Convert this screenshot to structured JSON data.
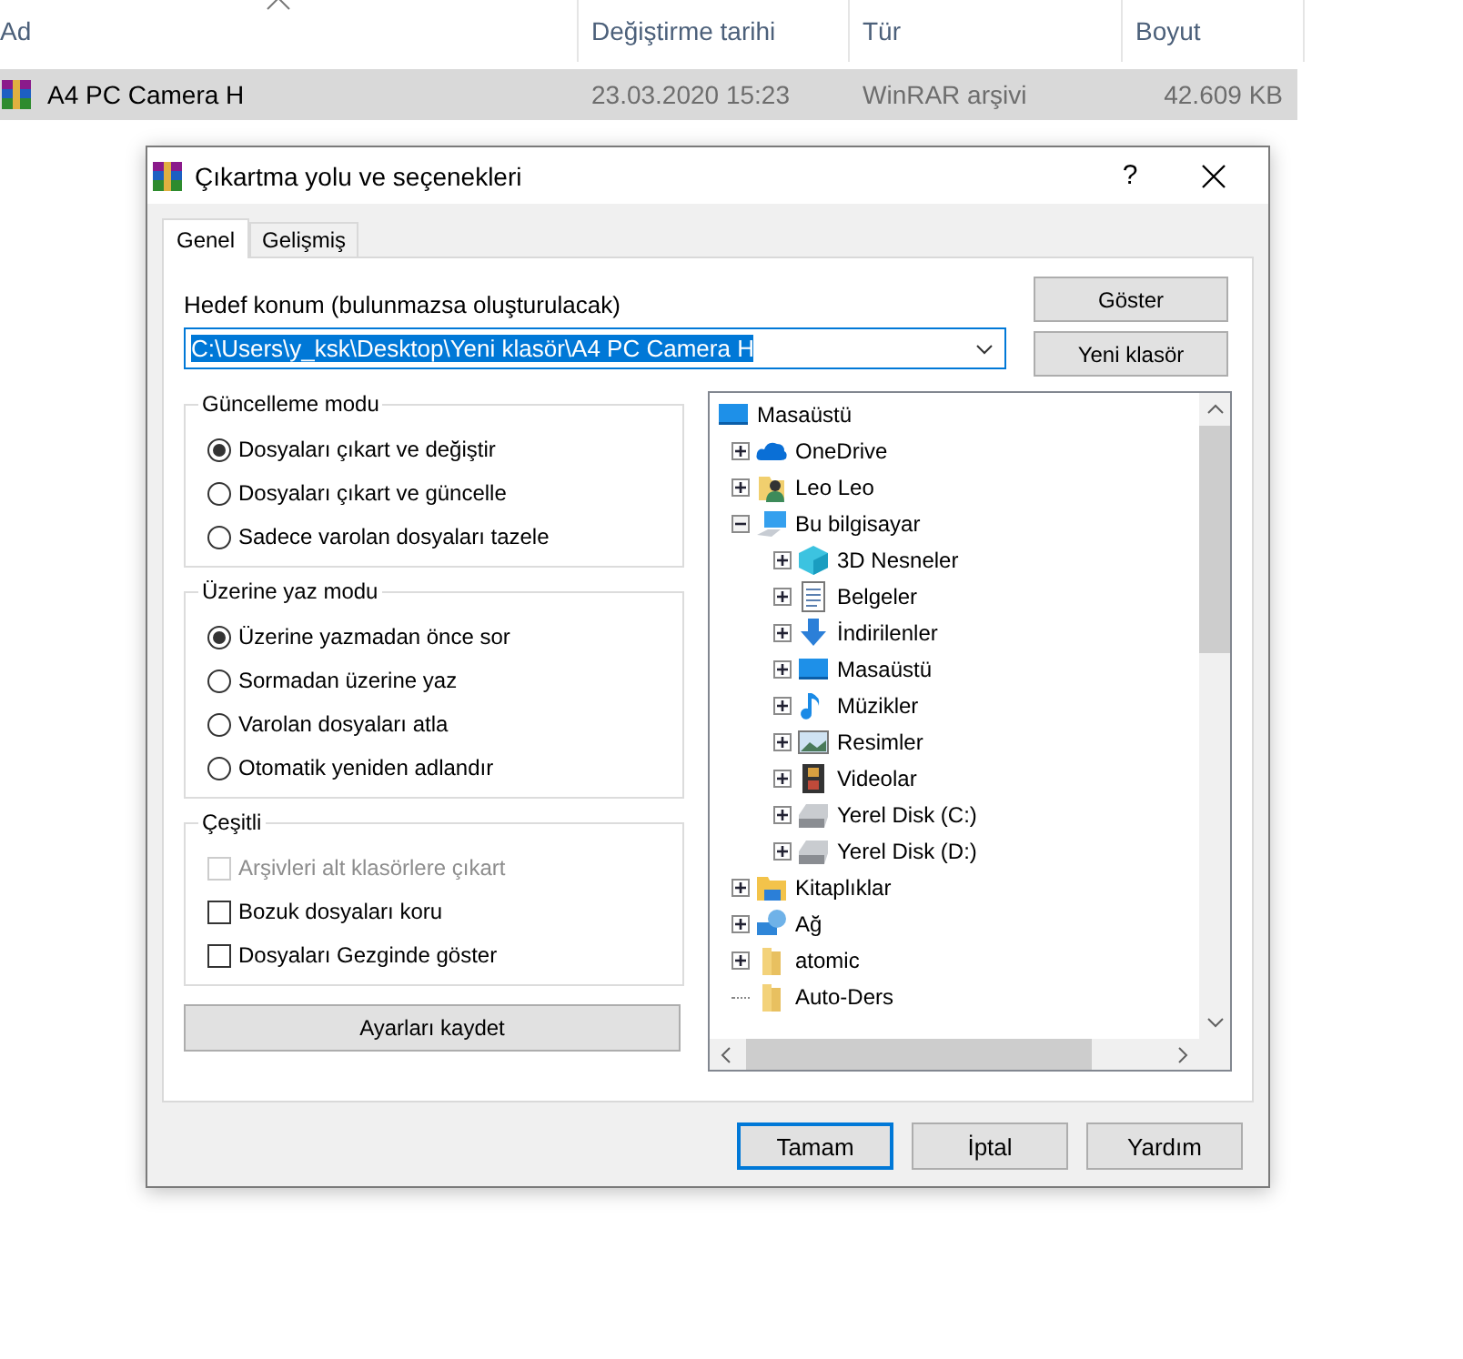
{
  "explorer": {
    "columns": [
      {
        "label": "Ad",
        "sorted": true
      },
      {
        "label": "Değiştirme tarihi",
        "sorted": false
      },
      {
        "label": "Tür",
        "sorted": false
      },
      {
        "label": "Boyut",
        "sorted": false
      }
    ],
    "rows": [
      {
        "name": "A4 PC Camera H",
        "date": "23.03.2020 15:23",
        "type": "WinRAR arşivi",
        "size": "42.609 KB",
        "selected": true
      }
    ]
  },
  "dialog": {
    "title": "Çıkartma yolu ve seçenekleri",
    "help": "?",
    "tabs": [
      {
        "label": "Genel",
        "selected": true
      },
      {
        "label": "Gelişmiş",
        "selected": false
      }
    ],
    "destination": {
      "label": "Hedef konum (bulunmazsa oluşturulacak)",
      "value": "C:\\Users\\y_ksk\\Desktop\\Yeni klasör\\A4 PC Camera H"
    },
    "side_buttons": [
      "Göster",
      "Yeni klasör"
    ],
    "radio_groups": [
      {
        "title": "Güncelleme modu",
        "options": [
          {
            "label": "Dosyaları çıkart ve değiştir",
            "selected": true
          },
          {
            "label": "Dosyaları çıkart ve güncelle",
            "selected": false
          },
          {
            "label": "Sadece varolan dosyaları tazele",
            "selected": false
          }
        ]
      },
      {
        "title": "Üzerine yaz modu",
        "options": [
          {
            "label": "Üzerine yazmadan önce sor",
            "selected": true
          },
          {
            "label": "Sormadan üzerine yaz",
            "selected": false
          },
          {
            "label": "Varolan dosyaları atla",
            "selected": false
          },
          {
            "label": "Otomatik yeniden adlandır",
            "selected": false
          }
        ]
      }
    ],
    "misc": {
      "title": "Çeşitli",
      "options": [
        {
          "label": "Arşivleri alt klasörlere çıkart",
          "checked": false,
          "disabled": true
        },
        {
          "label": "Bozuk dosyaları koru",
          "checked": false,
          "disabled": false
        },
        {
          "label": "Dosyaları Gezginde göster",
          "checked": false,
          "disabled": false
        }
      ]
    },
    "save_button": "Ayarları kaydet",
    "tree": {
      "label": "Masaüstü",
      "kind": "desktop",
      "children": [
        {
          "label": "OneDrive",
          "kind": "cloud",
          "expandable": true,
          "expanded": false
        },
        {
          "label": "Leo Leo",
          "kind": "user",
          "expandable": true,
          "expanded": false
        },
        {
          "label": "Bu bilgisayar",
          "kind": "computer",
          "expandable": true,
          "expanded": true,
          "children": [
            {
              "label": "3D Nesneler",
              "kind": "cube",
              "expandable": true,
              "expanded": false
            },
            {
              "label": "Belgeler",
              "kind": "document",
              "expandable": true,
              "expanded": false
            },
            {
              "label": "İndirilenler",
              "kind": "download",
              "expandable": true,
              "expanded": false
            },
            {
              "label": "Masaüstü",
              "kind": "desktop",
              "expandable": true,
              "expanded": false
            },
            {
              "label": "Müzikler",
              "kind": "music",
              "expandable": true,
              "expanded": false
            },
            {
              "label": "Resimler",
              "kind": "image",
              "expandable": true,
              "expanded": false
            },
            {
              "label": "Videolar",
              "kind": "video",
              "expandable": true,
              "expanded": false
            },
            {
              "label": "Yerel Disk (C:)",
              "kind": "disk",
              "expandable": true,
              "expanded": false
            },
            {
              "label": "Yerel Disk (D:)",
              "kind": "disk",
              "expandable": true,
              "expanded": false
            }
          ]
        },
        {
          "label": "Kitaplıklar",
          "kind": "library",
          "expandable": true,
          "expanded": false
        },
        {
          "label": "Ağ",
          "kind": "network",
          "expandable": true,
          "expanded": false
        },
        {
          "label": "atomic",
          "kind": "folder",
          "expandable": true,
          "expanded": false
        },
        {
          "label": "Auto-Ders",
          "kind": "folder",
          "expandable": false,
          "expanded": false
        }
      ]
    },
    "buttons": [
      {
        "label": "Tamam",
        "default": true
      },
      {
        "label": "İptal",
        "default": false
      },
      {
        "label": "Yardım",
        "default": false
      }
    ]
  }
}
